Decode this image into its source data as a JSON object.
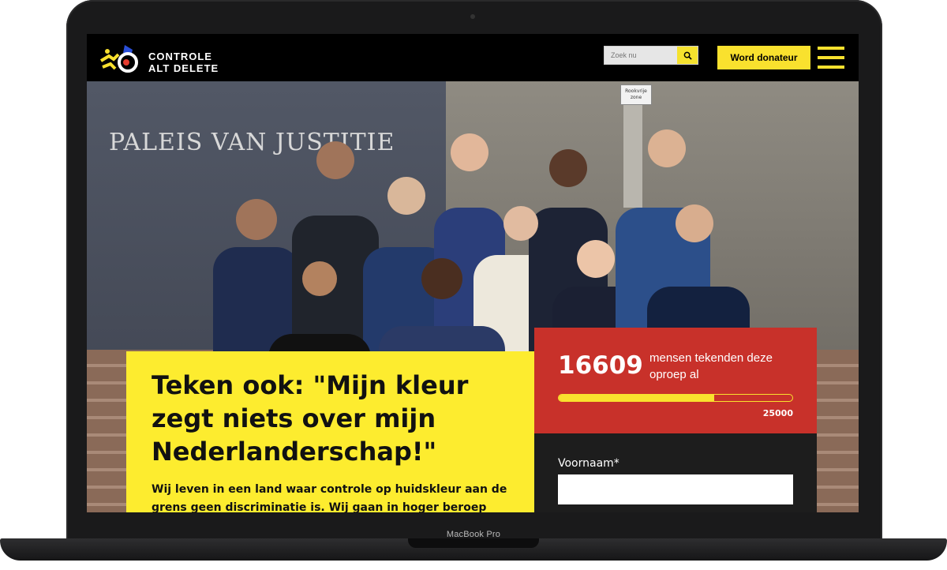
{
  "device": {
    "label": "MacBook Pro"
  },
  "header": {
    "logo_line1": "CONTROLE",
    "logo_line2": "ALT DELETE",
    "search_placeholder": "Zoek nu",
    "donate_label": "Word donateur"
  },
  "photo": {
    "wall_text": "PALEIS VAN JUSTITIE",
    "sign_text": "Rookvrije zone"
  },
  "petition": {
    "title": "Teken ook: \"Mijn kleur zegt niets over mijn Nederlanderschap!\"",
    "description": "Wij leven in een land waar controle op huidskleur aan de grens geen discriminatie is. Wij gaan in hoger beroep tegen"
  },
  "counter": {
    "count": "16609",
    "label": "mensen tekenden deze oproep al",
    "goal": "25000",
    "progress_fraction": 0.664
  },
  "form": {
    "first_name_label": "Voornaam*"
  },
  "colors": {
    "brand_yellow": "#fdec2f",
    "counter_red": "#c8312a",
    "header_black": "#000000"
  }
}
